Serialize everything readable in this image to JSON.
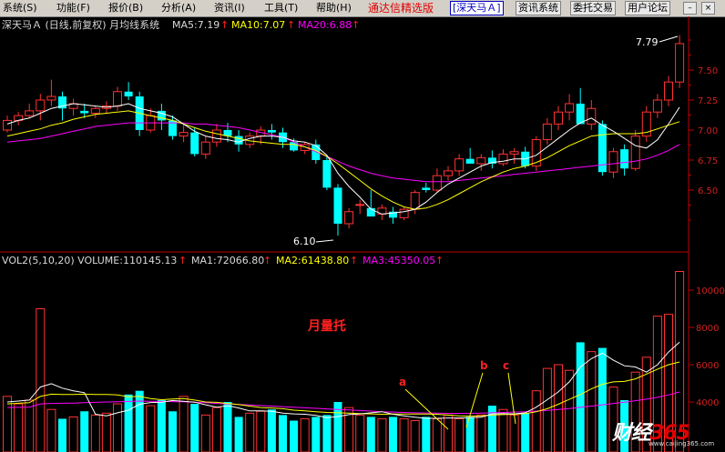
{
  "menu": {
    "items": [
      "系统(S)",
      "功能(F)",
      "报价(B)",
      "分析(A)",
      "资讯(I)",
      "工具(T)",
      "帮助(H)"
    ],
    "brand": "通达信精选版",
    "stock": "[深天马Ａ]",
    "buttons": [
      "资讯系统",
      "委托交易",
      "用户论坛"
    ],
    "window_controls": [
      "–",
      "×"
    ]
  },
  "price_panel": {
    "header": {
      "name": "深天马Ａ (日线,前复权) 月均线系统",
      "ma5": "MA5:7.19",
      "ma10": "MA10:7.07",
      "ma20": "MA20:6.88"
    },
    "high_label": "7.79",
    "low_label": "6.10",
    "y_ticks": [
      "7.50",
      "7.25",
      "7.00",
      "6.75",
      "6.50"
    ]
  },
  "volume_panel": {
    "header": {
      "name": "VOL2(5,10,20) VOLUME:110145.13",
      "ma1": "MA1:72066.80",
      "ma2": "MA2:61438.80",
      "ma3": "MA3:45350.05"
    },
    "y_ticks": [
      "10000",
      "8000",
      "6000",
      "4000"
    ],
    "annotation": "月量托",
    "markers": [
      "a",
      "b",
      "c"
    ]
  },
  "watermark": {
    "main": "财经",
    "accent": "365",
    "url": "www.caijing365.com"
  },
  "colors": {
    "up": "#ff3232",
    "down": "#00ffff",
    "ma5": "#ffffff",
    "ma10": "#ffff00",
    "ma20": "#ff00ff",
    "axis": "#c00000",
    "annotation": "#ff2020",
    "marker_line": "#ffff00"
  },
  "chart_data": [
    {
      "type": "candlestick",
      "title": "深天马Ａ (日线,前复权) 月均线系统",
      "ylim": [
        6.05,
        7.85
      ],
      "ohlc": [
        [
          7.0,
          7.12,
          6.98,
          7.08
        ],
        [
          7.08,
          7.15,
          7.04,
          7.12
        ],
        [
          7.12,
          7.22,
          7.1,
          7.16
        ],
        [
          7.16,
          7.3,
          7.08,
          7.25
        ],
        [
          7.25,
          7.42,
          7.2,
          7.28
        ],
        [
          7.28,
          7.32,
          7.08,
          7.18
        ],
        [
          7.18,
          7.26,
          7.12,
          7.22
        ],
        [
          7.16,
          7.22,
          7.1,
          7.14
        ],
        [
          7.14,
          7.2,
          7.1,
          7.18
        ],
        [
          7.18,
          7.24,
          7.14,
          7.2
        ],
        [
          7.2,
          7.36,
          7.16,
          7.32
        ],
        [
          7.32,
          7.4,
          7.25,
          7.28
        ],
        [
          7.28,
          7.32,
          6.95,
          7.0
        ],
        [
          7.0,
          7.18,
          6.98,
          7.12
        ],
        [
          7.16,
          7.22,
          7.0,
          7.08
        ],
        [
          7.08,
          7.12,
          6.92,
          6.95
        ],
        [
          6.95,
          7.05,
          6.9,
          6.98
        ],
        [
          6.98,
          7.02,
          6.78,
          6.8
        ],
        [
          6.8,
          6.95,
          6.76,
          6.9
        ],
        [
          6.9,
          7.05,
          6.86,
          7.0
        ],
        [
          7.0,
          7.06,
          6.9,
          6.95
        ],
        [
          6.95,
          7.0,
          6.82,
          6.88
        ],
        [
          6.88,
          6.98,
          6.85,
          6.95
        ],
        [
          6.95,
          7.03,
          6.88,
          7.0
        ],
        [
          7.0,
          7.05,
          6.92,
          6.98
        ],
        [
          6.98,
          7.02,
          6.85,
          6.9
        ],
        [
          6.9,
          6.93,
          6.82,
          6.83
        ],
        [
          6.83,
          6.9,
          6.8,
          6.88
        ],
        [
          6.88,
          6.92,
          6.72,
          6.75
        ],
        [
          6.75,
          6.78,
          6.5,
          6.52
        ],
        [
          6.52,
          6.55,
          6.12,
          6.22
        ],
        [
          6.22,
          6.35,
          6.18,
          6.32
        ],
        [
          6.38,
          6.42,
          6.3,
          6.38
        ],
        [
          6.35,
          6.5,
          6.28,
          6.28
        ],
        [
          6.3,
          6.38,
          6.25,
          6.35
        ],
        [
          6.32,
          6.36,
          6.22,
          6.27
        ],
        [
          6.27,
          6.36,
          6.25,
          6.34
        ],
        [
          6.34,
          6.5,
          6.3,
          6.48
        ],
        [
          6.52,
          6.56,
          6.48,
          6.5
        ],
        [
          6.5,
          6.68,
          6.48,
          6.62
        ],
        [
          6.62,
          6.7,
          6.58,
          6.66
        ],
        [
          6.66,
          6.8,
          6.62,
          6.76
        ],
        [
          6.76,
          6.85,
          6.72,
          6.72
        ],
        [
          6.72,
          6.8,
          6.66,
          6.77
        ],
        [
          6.77,
          6.83,
          6.68,
          6.72
        ],
        [
          6.72,
          6.84,
          6.7,
          6.8
        ],
        [
          6.8,
          6.85,
          6.72,
          6.82
        ],
        [
          6.82,
          6.86,
          6.68,
          6.7
        ],
        [
          6.7,
          6.95,
          6.66,
          6.92
        ],
        [
          6.92,
          7.1,
          6.88,
          7.05
        ],
        [
          7.05,
          7.2,
          7.0,
          7.15
        ],
        [
          7.15,
          7.3,
          7.08,
          7.22
        ],
        [
          7.22,
          7.35,
          7.05,
          7.05
        ],
        [
          7.05,
          7.25,
          7.0,
          7.18
        ],
        [
          7.05,
          7.08,
          6.62,
          6.65
        ],
        [
          6.65,
          6.85,
          6.6,
          6.82
        ],
        [
          6.84,
          6.88,
          6.62,
          6.68
        ],
        [
          6.68,
          7.0,
          6.66,
          6.95
        ],
        [
          6.95,
          7.2,
          6.9,
          7.15
        ],
        [
          7.15,
          7.3,
          7.1,
          7.25
        ],
        [
          7.25,
          7.45,
          7.2,
          7.4
        ],
        [
          7.4,
          7.79,
          7.35,
          7.72
        ]
      ],
      "ma5": [
        7.05,
        7.08,
        7.1,
        7.14,
        7.18,
        7.2,
        7.22,
        7.21,
        7.2,
        7.19,
        7.2,
        7.22,
        7.18,
        7.16,
        7.14,
        7.11,
        7.05,
        6.99,
        6.95,
        6.93,
        6.92,
        6.9,
        6.93,
        6.95,
        6.95,
        6.94,
        6.91,
        6.9,
        6.87,
        6.79,
        6.64,
        6.53,
        6.44,
        6.34,
        6.3,
        6.31,
        6.32,
        6.34,
        6.4,
        6.48,
        6.55,
        6.6,
        6.65,
        6.7,
        6.73,
        6.74,
        6.76,
        6.76,
        6.79,
        6.86,
        6.93,
        7.0,
        7.06,
        7.1,
        7.04,
        6.99,
        6.93,
        6.87,
        6.85,
        6.92,
        7.05,
        7.19
      ],
      "ma10": [
        6.95,
        6.97,
        6.99,
        7.01,
        7.04,
        7.06,
        7.09,
        7.11,
        7.13,
        7.14,
        7.15,
        7.16,
        7.14,
        7.12,
        7.1,
        7.08,
        7.05,
        7.02,
        6.99,
        6.97,
        6.95,
        6.93,
        6.91,
        6.9,
        6.89,
        6.88,
        6.88,
        6.86,
        6.83,
        6.78,
        6.72,
        6.65,
        6.58,
        6.51,
        6.45,
        6.4,
        6.36,
        6.34,
        6.35,
        6.38,
        6.42,
        6.47,
        6.52,
        6.57,
        6.61,
        6.65,
        6.68,
        6.7,
        6.73,
        6.77,
        6.82,
        6.87,
        6.91,
        6.95,
        6.96,
        6.97,
        6.97,
        6.97,
        6.98,
        7.01,
        7.04,
        7.07
      ],
      "ma20": [
        6.9,
        6.91,
        6.92,
        6.93,
        6.95,
        6.97,
        6.99,
        7.01,
        7.03,
        7.04,
        7.05,
        7.06,
        7.06,
        7.06,
        7.06,
        7.06,
        7.06,
        7.05,
        7.05,
        7.04,
        7.03,
        7.02,
        7.0,
        6.98,
        6.96,
        6.94,
        6.9,
        6.86,
        6.82,
        6.78,
        6.74,
        6.7,
        6.67,
        6.64,
        6.62,
        6.6,
        6.59,
        6.58,
        6.57,
        6.57,
        6.57,
        6.58,
        6.59,
        6.6,
        6.61,
        6.62,
        6.63,
        6.64,
        6.65,
        6.66,
        6.67,
        6.68,
        6.69,
        6.7,
        6.71,
        6.72,
        6.73,
        6.74,
        6.76,
        6.79,
        6.83,
        6.88
      ]
    },
    {
      "type": "bar",
      "title": "VOL2(5,10,20) VOLUME:110145.13",
      "ylim": [
        2600,
        11000
      ],
      "values": [
        4300,
        3900,
        4100,
        9000,
        3600,
        3100,
        3200,
        3500,
        3300,
        3400,
        3900,
        4400,
        4600,
        3800,
        4100,
        3500,
        4300,
        3900,
        3300,
        3700,
        4000,
        3200,
        3400,
        3500,
        3600,
        3300,
        3000,
        3100,
        3200,
        3300,
        4000,
        3700,
        3300,
        3200,
        3100,
        3200,
        3100,
        3000,
        3200,
        3100,
        3300,
        3100,
        3200,
        3300,
        3800,
        3600,
        3300,
        3400,
        4600,
        5800,
        6000,
        5700,
        7200,
        6700,
        6900,
        4800,
        4100,
        5600,
        6400,
        8600,
        8700,
        11000
      ],
      "ma1": [
        4000,
        4050,
        4100,
        4800,
        4980,
        4740,
        4600,
        4500,
        3340,
        3260,
        3420,
        3560,
        3880,
        3970,
        3990,
        4080,
        4040,
        3990,
        3850,
        3720,
        3800,
        3680,
        3520,
        3520,
        3500,
        3400,
        3360,
        3340,
        3280,
        3160,
        3220,
        3320,
        3360,
        3420,
        3480,
        3340,
        3260,
        3180,
        3120,
        3120,
        3140,
        3140,
        3160,
        3180,
        3360,
        3380,
        3360,
        3420,
        3720,
        4120,
        4540,
        5080,
        5880,
        6320,
        6620,
        6240,
        5940,
        5880,
        5600,
        6000,
        6680,
        7207
      ],
      "ma2": [
        3900,
        3930,
        3960,
        4300,
        4420,
        4400,
        4400,
        4420,
        4400,
        4400,
        4380,
        4280,
        4300,
        4180,
        4120,
        4160,
        4180,
        4100,
        4000,
        3980,
        3920,
        3860,
        3780,
        3700,
        3680,
        3640,
        3560,
        3520,
        3480,
        3440,
        3420,
        3400,
        3380,
        3360,
        3340,
        3350,
        3350,
        3350,
        3350,
        3340,
        3300,
        3260,
        3240,
        3260,
        3300,
        3320,
        3340,
        3380,
        3480,
        3640,
        3880,
        4140,
        4400,
        4700,
        4950,
        5080,
        5100,
        5240,
        5500,
        5760,
        6000,
        6144
      ],
      "ma3": [
        3700,
        3710,
        3720,
        3900,
        3920,
        3930,
        3940,
        3960,
        3980,
        4000,
        4010,
        4030,
        4050,
        4040,
        4030,
        4020,
        4010,
        3990,
        3960,
        3920,
        3900,
        3870,
        3840,
        3810,
        3780,
        3750,
        3720,
        3690,
        3660,
        3630,
        3600,
        3570,
        3540,
        3510,
        3480,
        3460,
        3440,
        3420,
        3410,
        3400,
        3390,
        3390,
        3390,
        3400,
        3420,
        3440,
        3460,
        3480,
        3510,
        3550,
        3600,
        3650,
        3710,
        3780,
        3850,
        3920,
        3990,
        4070,
        4150,
        4250,
        4380,
        4535
      ]
    }
  ]
}
